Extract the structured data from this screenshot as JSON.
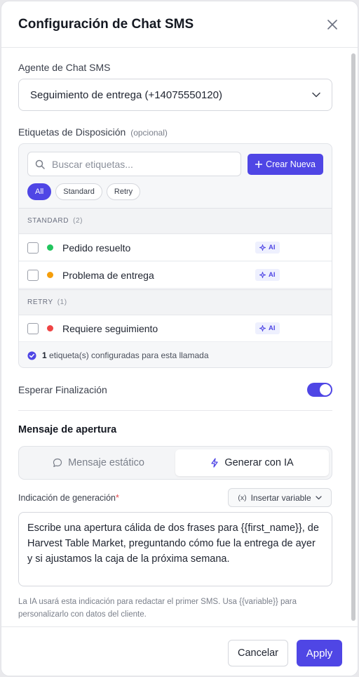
{
  "header": {
    "title": "Configuración de Chat SMS"
  },
  "agent": {
    "label": "Agente de Chat SMS",
    "selected": "Seguimiento de entrega (+14075550120)"
  },
  "tags": {
    "label": "Etiquetas de Disposición",
    "optional": "(opcional)",
    "search_placeholder": "Buscar etiquetas...",
    "create_label": "Crear Nueva",
    "filters": [
      "All",
      "Standard",
      "Retry"
    ],
    "groups": [
      {
        "name": "STANDARD",
        "count": "(2)",
        "items": [
          {
            "label": "Pedido resuelto",
            "color": "#22c55e",
            "badge": "AI"
          },
          {
            "label": "Problema de entrega",
            "color": "#f59e0b",
            "badge": "AI"
          }
        ]
      },
      {
        "name": "RETRY",
        "count": "(1)",
        "items": [
          {
            "label": "Requiere seguimiento",
            "color": "#ef4444",
            "badge": "AI"
          }
        ]
      }
    ],
    "summary_count": "1",
    "summary_text": "etiqueta(s) configuradas para esta llamada"
  },
  "wait": {
    "label": "Esperar Finalización",
    "enabled": true
  },
  "opening": {
    "title": "Mensaje de apertura",
    "options": [
      "Mensaje estático",
      "Generar con IA"
    ],
    "prompt_label": "Indicación de generación",
    "required_mark": "*",
    "insert_label": "Insertar variable",
    "insert_icon_text": "(x)",
    "prompt_text": "Escribe una apertura cálida de dos frases para {{first_name}}, de Harvest Table Market, preguntando cómo fue la entrega de ayer y si ajustamos la caja de la próxima semana.",
    "help_text": "La IA usará esta indicación para redactar el primer SMS. Usa {{variable}} para personalizarlo con datos del cliente."
  },
  "footer": {
    "cancel_label": "Cancelar",
    "apply_label": "Apply"
  },
  "colors": {
    "accent": "#4f46e5"
  }
}
